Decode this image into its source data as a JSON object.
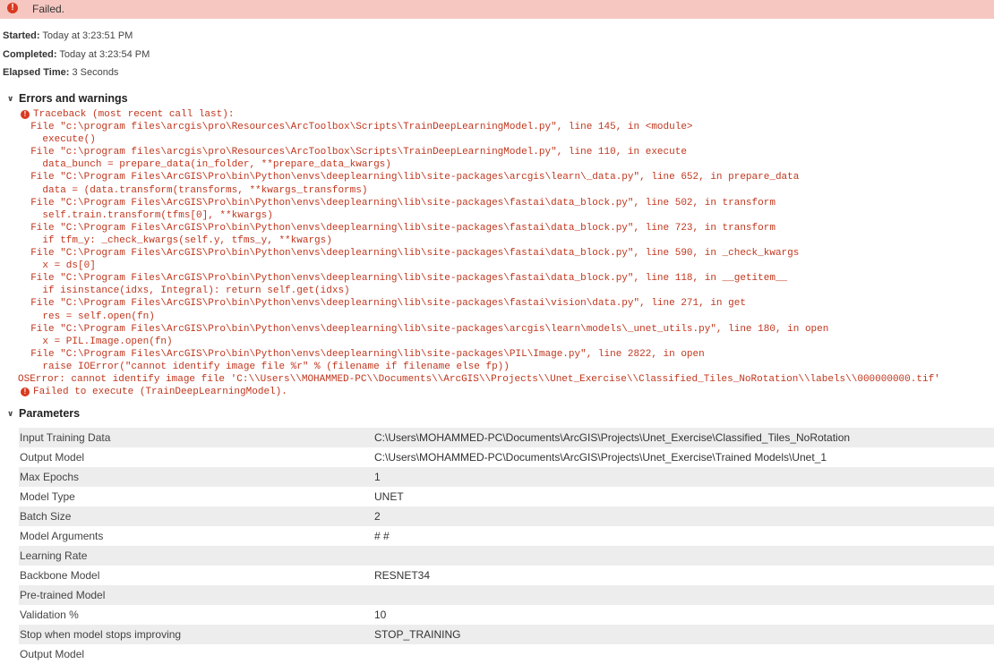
{
  "banner": {
    "status": "Failed.",
    "icon": "error-icon"
  },
  "meta": {
    "started_label": "Started:",
    "started_value": "Today at 3:23:51 PM",
    "completed_label": "Completed:",
    "completed_value": "Today at 3:23:54 PM",
    "elapsed_label": "Elapsed Time:",
    "elapsed_value": "3 Seconds"
  },
  "errors": {
    "title": "Errors and warnings",
    "lines": [
      {
        "text": "Traceback (most recent call last):",
        "kind": "error"
      },
      {
        "text": "  File \"c:\\program files\\arcgis\\pro\\Resources\\ArcToolbox\\Scripts\\TrainDeepLearningModel.py\", line 145, in <module>",
        "kind": "plain"
      },
      {
        "text": "    execute()",
        "kind": "plain"
      },
      {
        "text": "  File \"c:\\program files\\arcgis\\pro\\Resources\\ArcToolbox\\Scripts\\TrainDeepLearningModel.py\", line 110, in execute",
        "kind": "plain"
      },
      {
        "text": "    data_bunch = prepare_data(in_folder, **prepare_data_kwargs)",
        "kind": "plain"
      },
      {
        "text": "  File \"C:\\Program Files\\ArcGIS\\Pro\\bin\\Python\\envs\\deeplearning\\lib\\site-packages\\arcgis\\learn\\_data.py\", line 652, in prepare_data",
        "kind": "plain"
      },
      {
        "text": "    data = (data.transform(transforms, **kwargs_transforms)",
        "kind": "plain"
      },
      {
        "text": "  File \"C:\\Program Files\\ArcGIS\\Pro\\bin\\Python\\envs\\deeplearning\\lib\\site-packages\\fastai\\data_block.py\", line 502, in transform",
        "kind": "plain"
      },
      {
        "text": "    self.train.transform(tfms[0], **kwargs)",
        "kind": "plain"
      },
      {
        "text": "  File \"C:\\Program Files\\ArcGIS\\Pro\\bin\\Python\\envs\\deeplearning\\lib\\site-packages\\fastai\\data_block.py\", line 723, in transform",
        "kind": "plain"
      },
      {
        "text": "    if tfm_y: _check_kwargs(self.y, tfms_y, **kwargs)",
        "kind": "plain"
      },
      {
        "text": "  File \"C:\\Program Files\\ArcGIS\\Pro\\bin\\Python\\envs\\deeplearning\\lib\\site-packages\\fastai\\data_block.py\", line 590, in _check_kwargs",
        "kind": "plain"
      },
      {
        "text": "    x = ds[0]",
        "kind": "plain"
      },
      {
        "text": "  File \"C:\\Program Files\\ArcGIS\\Pro\\bin\\Python\\envs\\deeplearning\\lib\\site-packages\\fastai\\data_block.py\", line 118, in __getitem__",
        "kind": "plain"
      },
      {
        "text": "    if isinstance(idxs, Integral): return self.get(idxs)",
        "kind": "plain"
      },
      {
        "text": "  File \"C:\\Program Files\\ArcGIS\\Pro\\bin\\Python\\envs\\deeplearning\\lib\\site-packages\\fastai\\vision\\data.py\", line 271, in get",
        "kind": "plain"
      },
      {
        "text": "    res = self.open(fn)",
        "kind": "plain"
      },
      {
        "text": "  File \"C:\\Program Files\\ArcGIS\\Pro\\bin\\Python\\envs\\deeplearning\\lib\\site-packages\\arcgis\\learn\\models\\_unet_utils.py\", line 180, in open",
        "kind": "plain"
      },
      {
        "text": "    x = PIL.Image.open(fn)",
        "kind": "plain"
      },
      {
        "text": "  File \"C:\\Program Files\\ArcGIS\\Pro\\bin\\Python\\envs\\deeplearning\\lib\\site-packages\\PIL\\Image.py\", line 2822, in open",
        "kind": "plain"
      },
      {
        "text": "    raise IOError(\"cannot identify image file %r\" % (filename if filename else fp))",
        "kind": "plain"
      },
      {
        "text": "OSError: cannot identify image file 'C:\\\\Users\\\\MOHAMMED-PC\\\\Documents\\\\ArcGIS\\\\Projects\\\\Unet_Exercise\\\\Classified_Tiles_NoRotation\\\\labels\\\\000000000.tif'",
        "kind": "oserror"
      },
      {
        "text": "Failed to execute (TrainDeepLearningModel).",
        "kind": "error"
      }
    ]
  },
  "parameters": {
    "title": "Parameters",
    "rows": [
      {
        "name": "Input Training Data",
        "value": "C:\\Users\\MOHAMMED-PC\\Documents\\ArcGIS\\Projects\\Unet_Exercise\\Classified_Tiles_NoRotation"
      },
      {
        "name": "Output Model",
        "value": "C:\\Users\\MOHAMMED-PC\\Documents\\ArcGIS\\Projects\\Unet_Exercise\\Trained Models\\Unet_1"
      },
      {
        "name": "Max Epochs",
        "value": "1"
      },
      {
        "name": "Model Type",
        "value": "UNET"
      },
      {
        "name": "Batch Size",
        "value": "2"
      },
      {
        "name": "Model Arguments",
        "value": "# #"
      },
      {
        "name": "Learning Rate",
        "value": ""
      },
      {
        "name": "Backbone Model",
        "value": "RESNET34"
      },
      {
        "name": "Pre-trained Model",
        "value": ""
      },
      {
        "name": "Validation %",
        "value": "10"
      },
      {
        "name": "Stop when model stops improving",
        "value": "STOP_TRAINING"
      },
      {
        "name": "Output Model",
        "value": ""
      }
    ]
  }
}
